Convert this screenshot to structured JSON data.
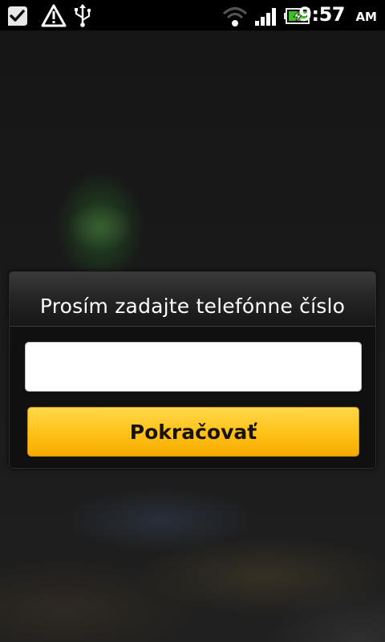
{
  "status_bar": {
    "time": "9:57",
    "ampm": "AM",
    "icons": [
      "notification-check-icon",
      "warning-icon",
      "usb-icon",
      "wifi-icon",
      "signal-icon",
      "battery-charging-icon"
    ],
    "colors": {
      "battery": "#3fbf22"
    }
  },
  "dialog": {
    "title": "Prosím zadajte telefónne číslo",
    "phone_input": {
      "value": "",
      "placeholder": ""
    },
    "continue_label": "Pokračovať",
    "colors": {
      "button": "#ffc31a"
    }
  }
}
